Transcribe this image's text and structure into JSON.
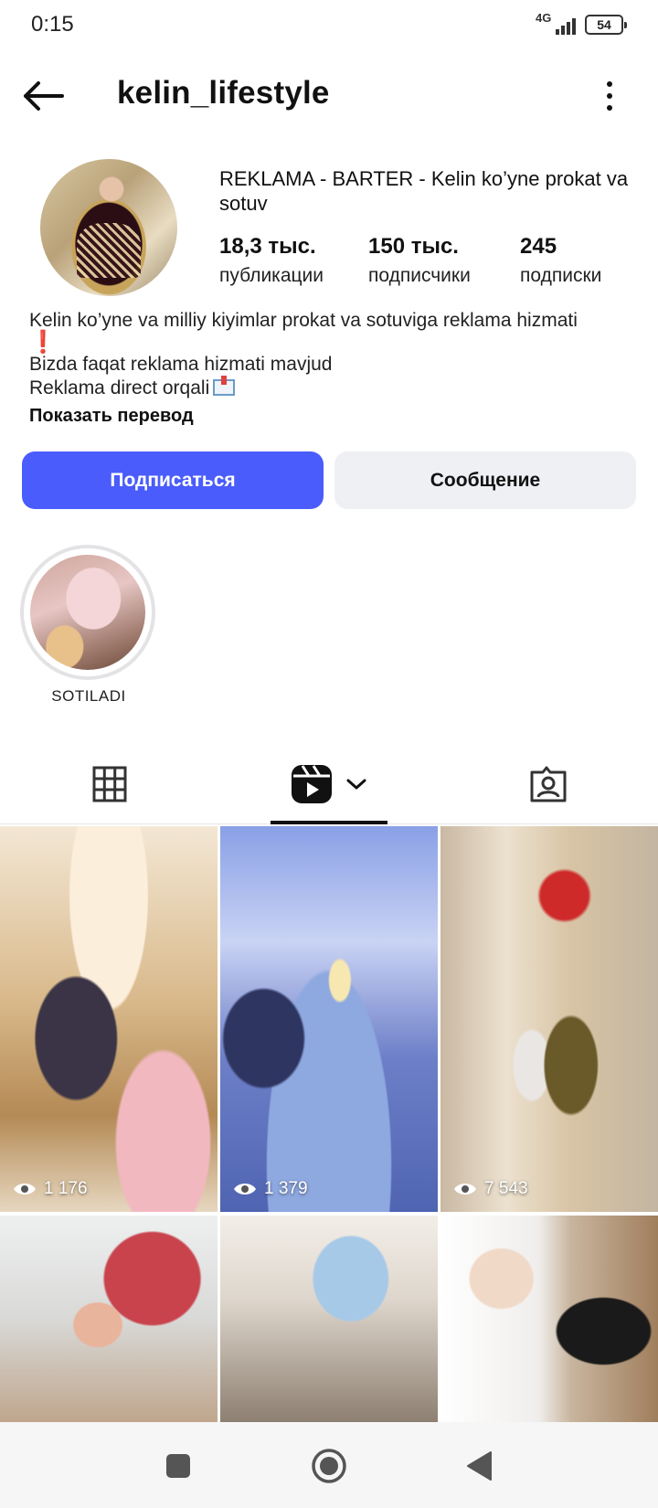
{
  "status_bar": {
    "time": "0:15",
    "network": "4G",
    "battery": "54"
  },
  "header": {
    "username": "kelin_lifestyle",
    "back_icon": "arrow-left-icon",
    "more_icon": "more-vertical-icon"
  },
  "profile": {
    "name": "REKLAMA - BARTER - Kelin ko’yne prokat va sotuv",
    "stats": [
      {
        "value": "18,3 тыс.",
        "label": "публикации"
      },
      {
        "value": "150 тыс.",
        "label": "подписчики"
      },
      {
        "value": "245",
        "label": "подписки"
      }
    ],
    "bio": {
      "line1": "Kelin ko’yne va milliy kiyimlar prokat va sotuviga reklama hizmati",
      "line1_emoji": "❗",
      "line2": "Bizda faqat reklama hizmati mavjud",
      "line3": "Reklama direct orqali"
    },
    "translate_link": "Показать перевод"
  },
  "actions": {
    "follow": "Подписаться",
    "message": "Сообщение"
  },
  "highlights": [
    {
      "label": "SOTILADI"
    }
  ],
  "tabs": {
    "grid_icon": "grid-icon",
    "reels_icon": "reels-icon",
    "tagged_icon": "tagged-user-icon",
    "active": "reels"
  },
  "reels": [
    {
      "views": "1 176"
    },
    {
      "views": "1 379"
    },
    {
      "views": "7 543"
    },
    {
      "views": ""
    },
    {
      "views": ""
    },
    {
      "views": ""
    }
  ],
  "nav": {
    "recent_icon": "recent-apps-icon",
    "home_icon": "home-icon",
    "back_icon": "back-triangle-icon"
  },
  "colors": {
    "accent": "#4a5cfb",
    "secondary_button": "#eff0f4"
  }
}
